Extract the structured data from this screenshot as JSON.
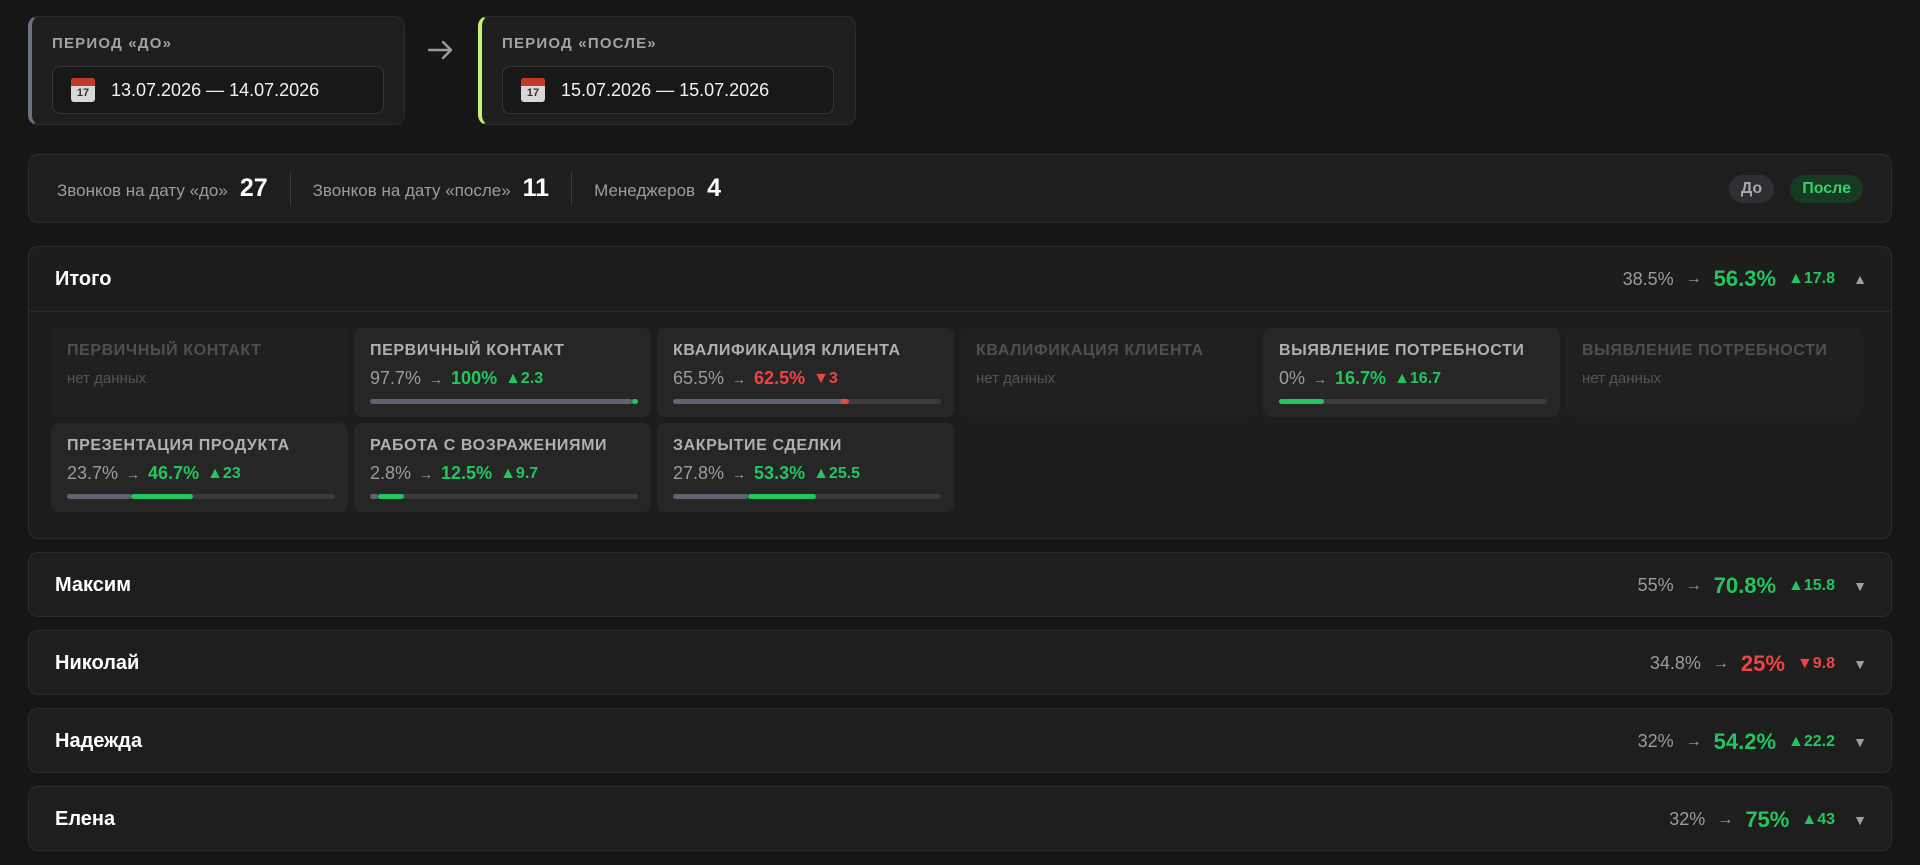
{
  "periods": {
    "before": {
      "label": "ПЕРИОД «ДО»",
      "dates": "13.07.2026 — 14.07.2026",
      "icon": "calendar-icon",
      "accent": "#6b7280"
    },
    "after": {
      "label": "ПЕРИОД «ПОСЛЕ»",
      "dates": "15.07.2026 — 15.07.2026",
      "icon": "calendar-icon",
      "accent": "#c9f26b"
    },
    "calendar_day": "17"
  },
  "stats": {
    "calls_before_label": "Звонков на дату «до»",
    "calls_before_value": "27",
    "calls_after_label": "Звонков на дату «после»",
    "calls_after_value": "11",
    "managers_label": "Менеджеров",
    "managers_value": "4"
  },
  "legend": {
    "before": "До",
    "after": "После"
  },
  "colors": {
    "up": "#22c55e",
    "down": "#ef4444",
    "before_bar": "#5f6470"
  },
  "total": {
    "name": "Итого",
    "before": "38.5%",
    "after": "56.3%",
    "delta": "▲17.8",
    "trend": "up",
    "expanded": true,
    "chevron": "▲",
    "cards": [
      {
        "title": "ПЕРВИЧНЫЙ КОНТАКТ",
        "empty": true,
        "nodata": "нет данных"
      },
      {
        "title": "ПЕРВИЧНЫЙ КОНТАКТ",
        "empty": false,
        "before": "97.7%",
        "after": "100%",
        "delta": "▲2.3",
        "trend": "up",
        "before_frac": 0.977,
        "after_frac": 1.0
      },
      {
        "title": "КВАЛИФИКАЦИЯ КЛИЕНТА",
        "empty": false,
        "before": "65.5%",
        "after": "62.5%",
        "delta": "▼3",
        "trend": "down",
        "before_frac": 0.655,
        "after_frac": 0.625
      },
      {
        "title": "КВАЛИФИКАЦИЯ КЛИЕНТА",
        "empty": true,
        "nodata": "нет данных"
      },
      {
        "title": "ВЫЯВЛЕНИЕ ПОТРЕБНОСТИ",
        "empty": false,
        "before": "0%",
        "after": "16.7%",
        "delta": "▲16.7",
        "trend": "up",
        "before_frac": 0.0,
        "after_frac": 0.167
      },
      {
        "title": "ВЫЯВЛЕНИЕ ПОТРЕБНОСТИ",
        "empty": true,
        "nodata": "нет данных"
      },
      {
        "title": "ПРЕЗЕНТАЦИЯ ПРОДУКТА",
        "empty": false,
        "before": "23.7%",
        "after": "46.7%",
        "delta": "▲23",
        "trend": "up",
        "before_frac": 0.237,
        "after_frac": 0.467
      },
      {
        "title": "РАБОТА С ВОЗРАЖЕНИЯМИ",
        "empty": false,
        "before": "2.8%",
        "after": "12.5%",
        "delta": "▲9.7",
        "trend": "up",
        "before_frac": 0.028,
        "after_frac": 0.125
      },
      {
        "title": "ЗАКРЫТИЕ СДЕЛКИ",
        "empty": false,
        "before": "27.8%",
        "after": "53.3%",
        "delta": "▲25.5",
        "trend": "up",
        "before_frac": 0.278,
        "after_frac": 0.533
      }
    ]
  },
  "managers": [
    {
      "name": "Максим",
      "before": "55%",
      "after": "70.8%",
      "delta": "▲15.8",
      "trend": "up",
      "chevron": "▼"
    },
    {
      "name": "Николай",
      "before": "34.8%",
      "after": "25%",
      "delta": "▼9.8",
      "trend": "down",
      "chevron": "▼"
    },
    {
      "name": "Надежда",
      "before": "32%",
      "after": "54.2%",
      "delta": "▲22.2",
      "trend": "up",
      "chevron": "▼"
    },
    {
      "name": "Елена",
      "before": "32%",
      "after": "75%",
      "delta": "▲43",
      "trend": "up",
      "chevron": "▼"
    }
  ]
}
